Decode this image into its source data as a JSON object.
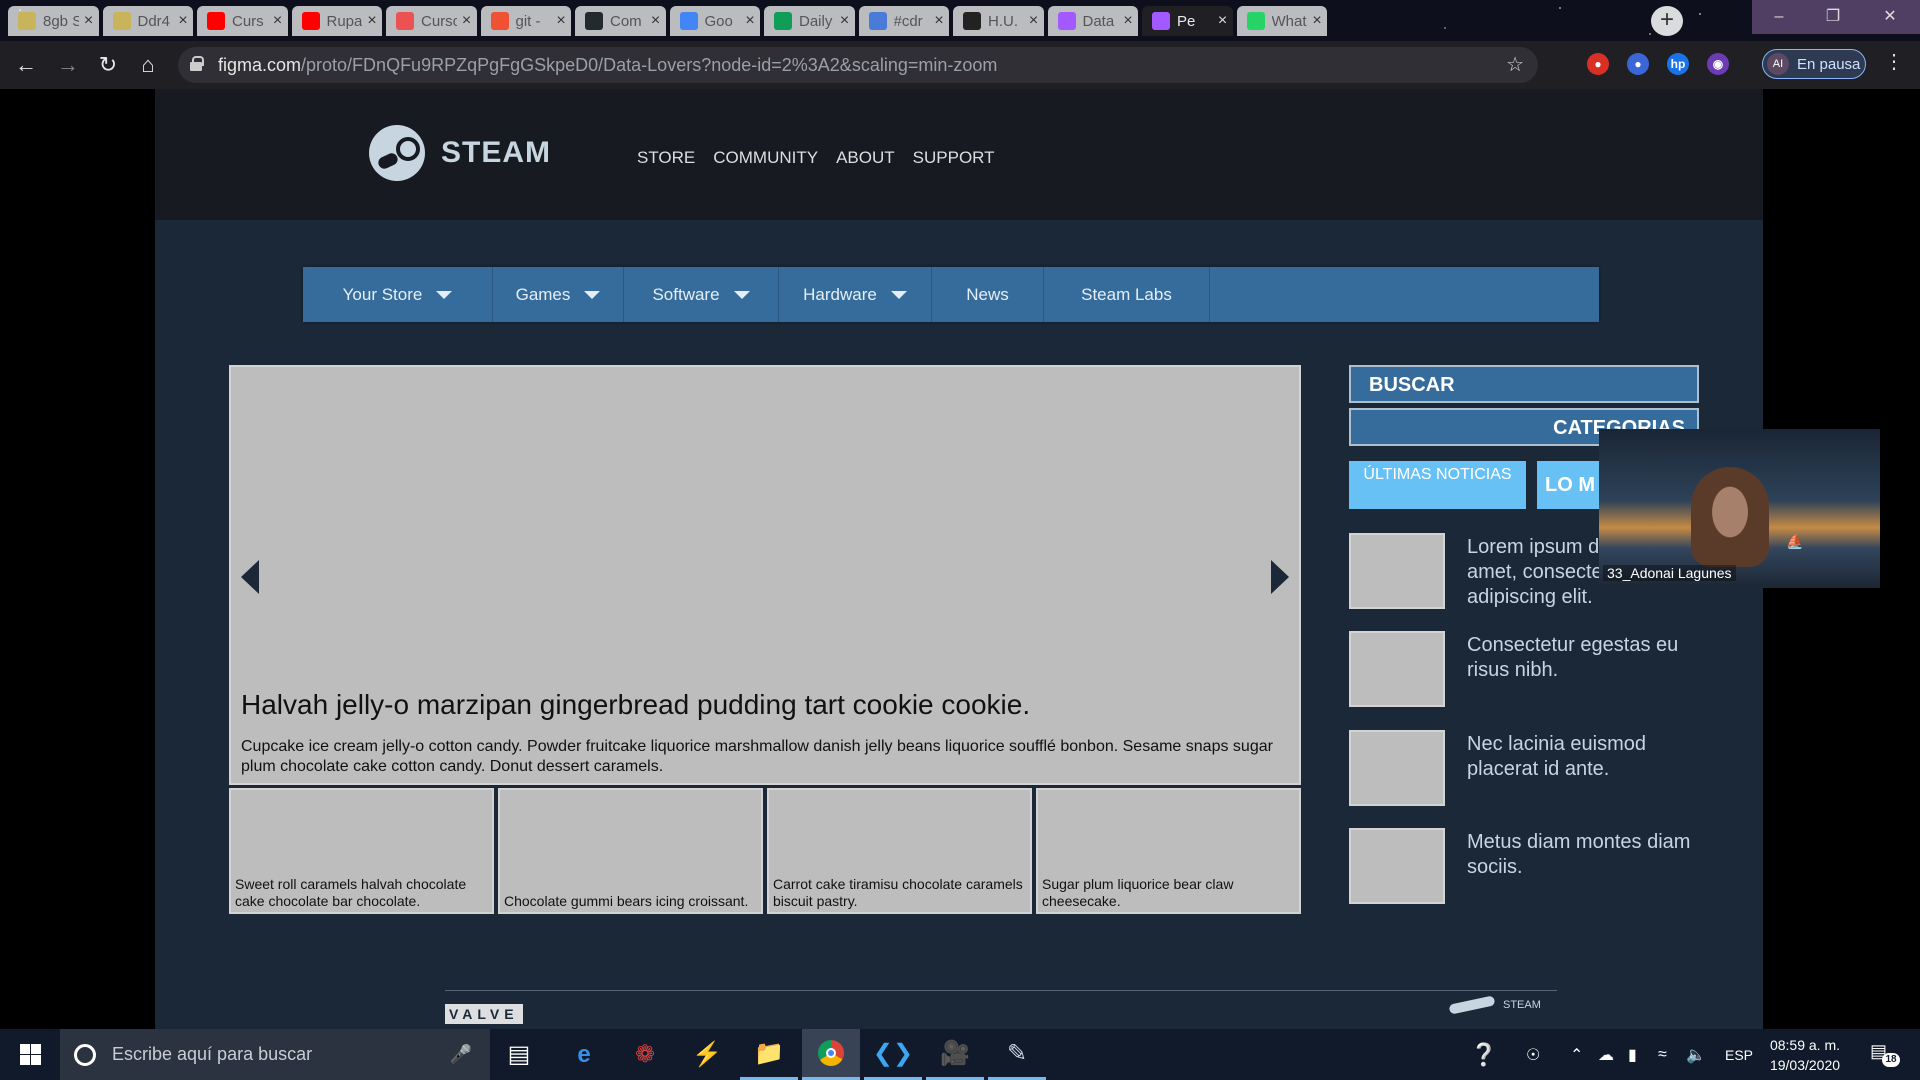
{
  "browser": {
    "tabs": [
      {
        "title": "8gb S",
        "icon": "coin-icon",
        "color": "#c8b45a"
      },
      {
        "title": "Ddr4",
        "icon": "coin-icon",
        "color": "#c8b45a"
      },
      {
        "title": "Curs",
        "icon": "youtube-icon",
        "color": "#ff0000"
      },
      {
        "title": "Rupa",
        "icon": "youtube-icon",
        "color": "#ff0000"
      },
      {
        "title": "Curso",
        "icon": "udemy-icon",
        "color": "#ec5252"
      },
      {
        "title": "git - ",
        "icon": "git-icon",
        "color": "#f05133"
      },
      {
        "title": "Com",
        "icon": "github-icon",
        "color": "#24292e"
      },
      {
        "title": "Goo",
        "icon": "calendar-icon",
        "color": "#4285f4"
      },
      {
        "title": "Daily",
        "icon": "sheets-icon",
        "color": "#0f9d58"
      },
      {
        "title": "#cdr",
        "icon": "chat-icon",
        "color": "#4a7bd8"
      },
      {
        "title": "H.U.",
        "icon": "notion-icon",
        "color": "#222222"
      },
      {
        "title": "Data",
        "icon": "figma-icon",
        "color": "#a259ff"
      },
      {
        "title": "Pe",
        "icon": "figma-icon",
        "color": "#a259ff",
        "active": true
      },
      {
        "title": "What",
        "icon": "whatsapp-icon",
        "color": "#25d366"
      }
    ],
    "url_domain": "figma.com",
    "url_path": "/proto/FDnQFu9RPZqPgFgGSkpeD0/Data-Lovers?node-id=2%3A2&scaling=min-zoom",
    "profile_initials": "AI",
    "profile_label": "En pausa"
  },
  "steam": {
    "brand": "STEAM",
    "top_nav": [
      "STORE",
      "COMMUNITY",
      "ABOUT",
      "SUPPORT"
    ],
    "main_nav": [
      {
        "label": "Your Store",
        "dropdown": true
      },
      {
        "label": "Games",
        "dropdown": true
      },
      {
        "label": "Software",
        "dropdown": true
      },
      {
        "label": "Hardware",
        "dropdown": true
      },
      {
        "label": "News",
        "dropdown": false
      },
      {
        "label": "Steam Labs",
        "dropdown": false
      }
    ],
    "hero": {
      "title": "Halvah jelly-o marzipan gingerbread pudding tart cookie cookie.",
      "description": "Cupcake ice cream jelly-o cotton candy. Powder fruitcake liquorice marshmallow danish jelly beans liquorice soufflé bonbon. Sesame snaps sugar plum chocolate cake cotton candy. Donut dessert caramels."
    },
    "thumbs": [
      "Sweet roll caramels halvah chocolate cake chocolate bar chocolate.",
      "Chocolate gummi bears icing croissant.",
      "Carrot cake tiramisu chocolate caramels biscuit pastry.",
      "Sugar plum liquorice bear claw cheesecake."
    ],
    "sidebar": {
      "search_label": "BUSCAR",
      "categories_label": "CATEGORIAS",
      "tab_latest": "ÚLTIMAS NOTICIAS",
      "tab_most": "LO M",
      "news": [
        "Lorem ipsum dolor sit amet, consectetur adipiscing elit.",
        "Consectetur egestas eu risus nibh.",
        "Nec lacinia euismod placerat id ante.",
        "Metus diam montes diam sociis."
      ]
    },
    "footer": {
      "valve": "VALVE",
      "steam": "STEAM"
    }
  },
  "webcam": {
    "name": "33_Adonai Lagunes"
  },
  "taskbar": {
    "search_placeholder": "Escribe aquí para buscar",
    "language": "ESP",
    "time": "08:59 a. m.",
    "date": "19/03/2020",
    "notifications": "18"
  }
}
